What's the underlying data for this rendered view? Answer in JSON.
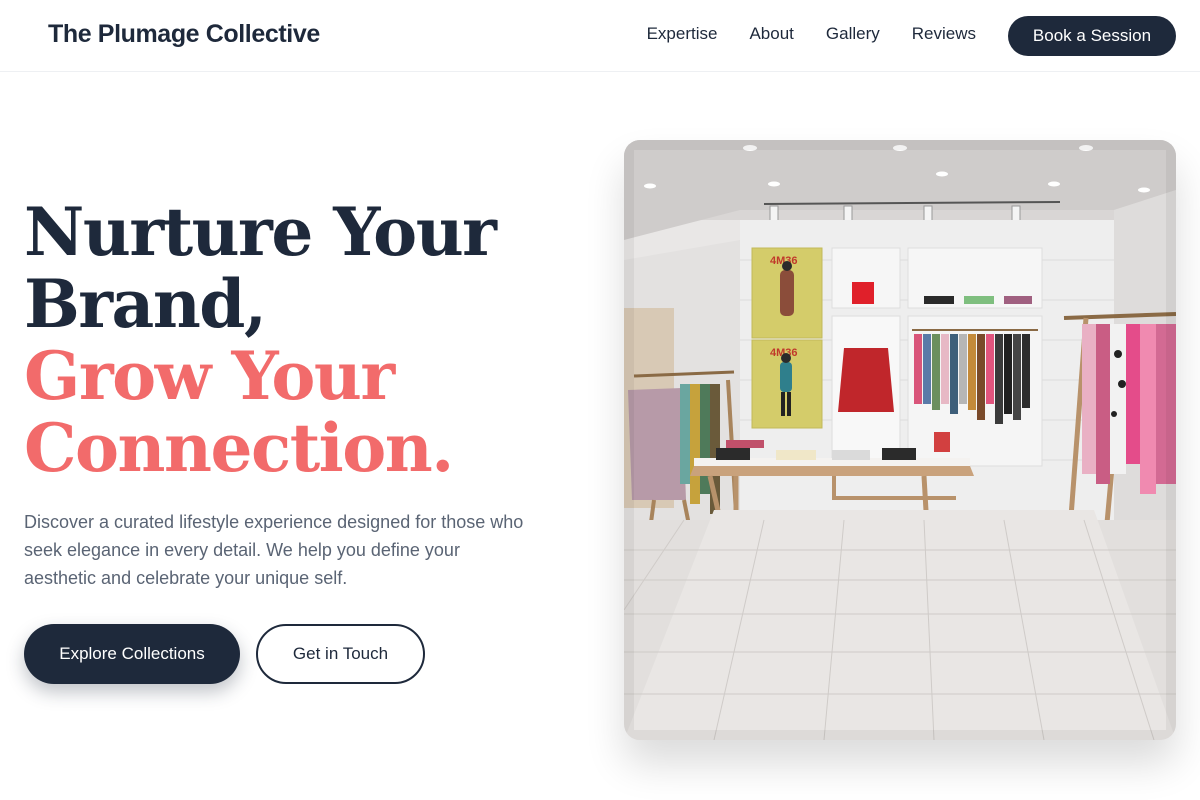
{
  "header": {
    "brand": "The Plumage Collective",
    "nav": [
      "Expertise",
      "About",
      "Gallery",
      "Reviews"
    ],
    "cta": "Book a Session"
  },
  "hero": {
    "headline_line1": "Nurture Your",
    "headline_line2": "Brand,",
    "headline_line3": "Grow Your",
    "headline_line4": "Connection.",
    "description": "Discover a curated lifestyle experience designed for those who seek elegance in every detail. We help you define your aesthetic and celebrate your unique self.",
    "primary_button": "Explore Collections",
    "secondary_button": "Get in Touch",
    "image": {
      "poster_text_1": "4M36",
      "poster_text_2": "4M36"
    }
  },
  "colors": {
    "navy": "#1e293b",
    "coral": "#f26b6b",
    "body_text": "#5a6474"
  }
}
